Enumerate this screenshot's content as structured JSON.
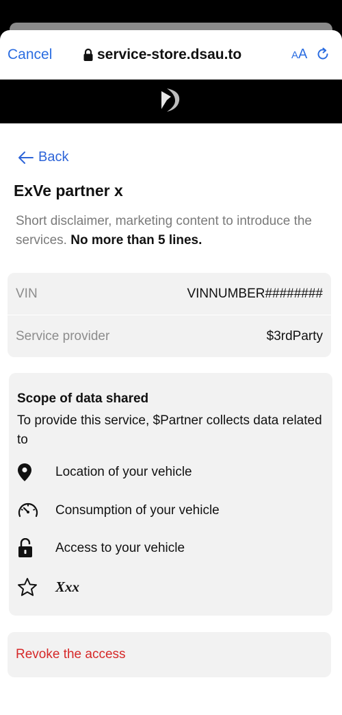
{
  "browser": {
    "cancel_label": "Cancel",
    "url": "service-store.dsau.to",
    "text_size_label_small": "A",
    "text_size_label_large": "A",
    "accent_color": "#2b6de1"
  },
  "page": {
    "back_label": "Back",
    "title": "ExVe partner x",
    "disclaimer_main": "Short disclaimer, marketing content to introduce the services.",
    "disclaimer_bold": "No more than 5 lines."
  },
  "info": {
    "vin_label": "VIN",
    "vin_value": "VINNUMBER########",
    "provider_label": "Service provider",
    "provider_value": "$3rdParty"
  },
  "scope": {
    "title": "Scope of data shared",
    "description": "To provide this service, $Partner collects data related to",
    "items": [
      {
        "icon": "location-pin-icon",
        "label": "Location of your vehicle"
      },
      {
        "icon": "speedometer-icon",
        "label": "Consumption of your vehicle"
      },
      {
        "icon": "unlocked-padlock-icon",
        "label": "Access to your vehicle"
      },
      {
        "icon": "star-icon",
        "label": "Xxx"
      }
    ]
  },
  "revoke": {
    "label": "Revoke the access",
    "color": "#d62828"
  }
}
